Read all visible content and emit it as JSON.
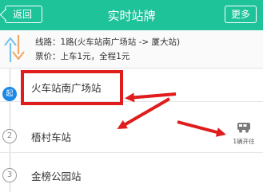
{
  "header": {
    "back_label": "返回",
    "title": "实时站牌",
    "more_label": "更多"
  },
  "route": {
    "line": "线路：1路(火车站南广场站 -> 厦大站)",
    "fare": "票价：上车1元，全程1元"
  },
  "stops": [
    {
      "marker": "起",
      "name": "火车站南广场站"
    },
    {
      "marker": "2",
      "name": "梧村车站"
    },
    {
      "marker": "3",
      "name": "金榜公园站"
    }
  ],
  "bus": {
    "label": "1辆开往"
  },
  "colors": {
    "header": "#1ec39a",
    "annotation": "#e01c1c",
    "start_marker": "#1e88e5"
  }
}
